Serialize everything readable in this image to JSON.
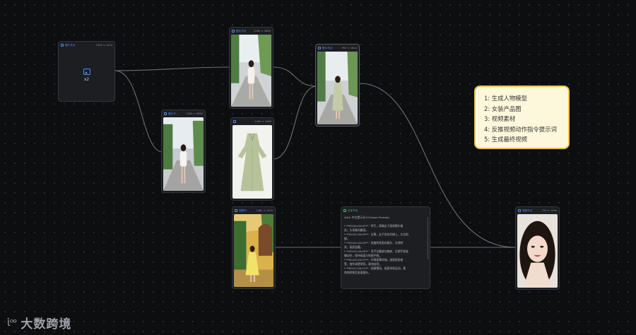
{
  "nodes": {
    "input": {
      "title": "图片节点",
      "size": "1024 × 1024",
      "count": "x2"
    },
    "model_a": {
      "title": "图片节点",
      "size": "2160 × 3840"
    },
    "model_b": {
      "title": "图片节...",
      "size": "2160 × 3840"
    },
    "dress": {
      "title": "",
      "size": "1440 × 2560"
    },
    "result": {
      "title": "图片节点",
      "size": "961 × 1612"
    },
    "video_src": {
      "title": "视频节...",
      "size": "1080 × 1920"
    },
    "text": {
      "title": "文本节点",
      "lines": [
        "### 中文提示词 (Chinese Prompt)",
        "",
        "* **00:00-00:01**：特写，高端女子面部镜头微",
        "笑，头发微风飘扬。",
        "* **00:01-00:02**：全景，女子坐在阶梯上，左边拍",
        "摄。",
        "* **00:02-00:03**：快速转身面向镜头，光线明",
        "亮，画面温暖。",
        "* **00:03-00:05**：双手交握放在胸前，后期手部变",
        "慢动作，保持画面与构图平稳。",
        "* **00:05-00:07**：环境背景伴随，画面视觉感",
        "受，细节清楚明亮，柔和自然。",
        "* **00:07-00:11**：轻微摆动，画面持续运动，柔",
        "和地转移至画面镜头。"
      ]
    },
    "video_out": {
      "title": "视频节点",
      "size": "720 × 1280"
    }
  },
  "note": {
    "items": [
      "1:   生成人物模型",
      "2:   女装产品图",
      "3:   视频素材",
      "4:   反推视频动作指令提示词",
      "5:   生成最终视频"
    ]
  },
  "brand": {
    "logo": "ɩ҅ᵒᵒ",
    "name": "大数跨境"
  },
  "colors": {
    "canvas": "#0d0e10",
    "node": "#1c1e22",
    "accent": "#5b8dee",
    "text_node": "#3ec47a",
    "note_bg": "#fdf8dc",
    "note_border": "#e8c24a"
  }
}
